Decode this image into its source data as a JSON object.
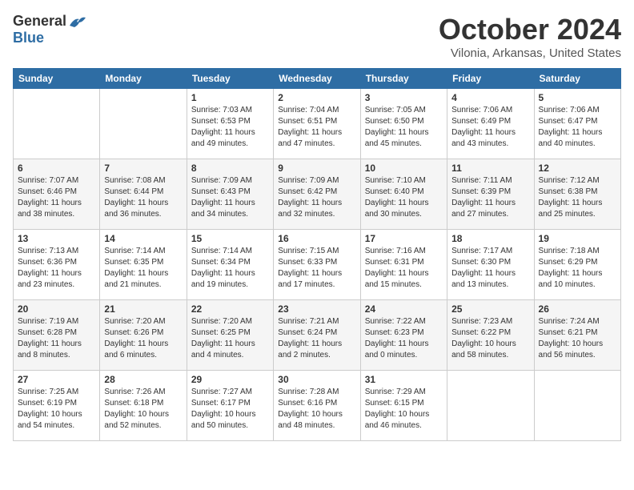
{
  "logo": {
    "general": "General",
    "blue": "Blue"
  },
  "title": "October 2024",
  "location": "Vilonia, Arkansas, United States",
  "headers": [
    "Sunday",
    "Monday",
    "Tuesday",
    "Wednesday",
    "Thursday",
    "Friday",
    "Saturday"
  ],
  "weeks": [
    {
      "shaded": false,
      "days": [
        {
          "num": "",
          "info": ""
        },
        {
          "num": "",
          "info": ""
        },
        {
          "num": "1",
          "info": "Sunrise: 7:03 AM\nSunset: 6:53 PM\nDaylight: 11 hours and 49 minutes."
        },
        {
          "num": "2",
          "info": "Sunrise: 7:04 AM\nSunset: 6:51 PM\nDaylight: 11 hours and 47 minutes."
        },
        {
          "num": "3",
          "info": "Sunrise: 7:05 AM\nSunset: 6:50 PM\nDaylight: 11 hours and 45 minutes."
        },
        {
          "num": "4",
          "info": "Sunrise: 7:06 AM\nSunset: 6:49 PM\nDaylight: 11 hours and 43 minutes."
        },
        {
          "num": "5",
          "info": "Sunrise: 7:06 AM\nSunset: 6:47 PM\nDaylight: 11 hours and 40 minutes."
        }
      ]
    },
    {
      "shaded": true,
      "days": [
        {
          "num": "6",
          "info": "Sunrise: 7:07 AM\nSunset: 6:46 PM\nDaylight: 11 hours and 38 minutes."
        },
        {
          "num": "7",
          "info": "Sunrise: 7:08 AM\nSunset: 6:44 PM\nDaylight: 11 hours and 36 minutes."
        },
        {
          "num": "8",
          "info": "Sunrise: 7:09 AM\nSunset: 6:43 PM\nDaylight: 11 hours and 34 minutes."
        },
        {
          "num": "9",
          "info": "Sunrise: 7:09 AM\nSunset: 6:42 PM\nDaylight: 11 hours and 32 minutes."
        },
        {
          "num": "10",
          "info": "Sunrise: 7:10 AM\nSunset: 6:40 PM\nDaylight: 11 hours and 30 minutes."
        },
        {
          "num": "11",
          "info": "Sunrise: 7:11 AM\nSunset: 6:39 PM\nDaylight: 11 hours and 27 minutes."
        },
        {
          "num": "12",
          "info": "Sunrise: 7:12 AM\nSunset: 6:38 PM\nDaylight: 11 hours and 25 minutes."
        }
      ]
    },
    {
      "shaded": false,
      "days": [
        {
          "num": "13",
          "info": "Sunrise: 7:13 AM\nSunset: 6:36 PM\nDaylight: 11 hours and 23 minutes."
        },
        {
          "num": "14",
          "info": "Sunrise: 7:14 AM\nSunset: 6:35 PM\nDaylight: 11 hours and 21 minutes."
        },
        {
          "num": "15",
          "info": "Sunrise: 7:14 AM\nSunset: 6:34 PM\nDaylight: 11 hours and 19 minutes."
        },
        {
          "num": "16",
          "info": "Sunrise: 7:15 AM\nSunset: 6:33 PM\nDaylight: 11 hours and 17 minutes."
        },
        {
          "num": "17",
          "info": "Sunrise: 7:16 AM\nSunset: 6:31 PM\nDaylight: 11 hours and 15 minutes."
        },
        {
          "num": "18",
          "info": "Sunrise: 7:17 AM\nSunset: 6:30 PM\nDaylight: 11 hours and 13 minutes."
        },
        {
          "num": "19",
          "info": "Sunrise: 7:18 AM\nSunset: 6:29 PM\nDaylight: 11 hours and 10 minutes."
        }
      ]
    },
    {
      "shaded": true,
      "days": [
        {
          "num": "20",
          "info": "Sunrise: 7:19 AM\nSunset: 6:28 PM\nDaylight: 11 hours and 8 minutes."
        },
        {
          "num": "21",
          "info": "Sunrise: 7:20 AM\nSunset: 6:26 PM\nDaylight: 11 hours and 6 minutes."
        },
        {
          "num": "22",
          "info": "Sunrise: 7:20 AM\nSunset: 6:25 PM\nDaylight: 11 hours and 4 minutes."
        },
        {
          "num": "23",
          "info": "Sunrise: 7:21 AM\nSunset: 6:24 PM\nDaylight: 11 hours and 2 minutes."
        },
        {
          "num": "24",
          "info": "Sunrise: 7:22 AM\nSunset: 6:23 PM\nDaylight: 11 hours and 0 minutes."
        },
        {
          "num": "25",
          "info": "Sunrise: 7:23 AM\nSunset: 6:22 PM\nDaylight: 10 hours and 58 minutes."
        },
        {
          "num": "26",
          "info": "Sunrise: 7:24 AM\nSunset: 6:21 PM\nDaylight: 10 hours and 56 minutes."
        }
      ]
    },
    {
      "shaded": false,
      "days": [
        {
          "num": "27",
          "info": "Sunrise: 7:25 AM\nSunset: 6:19 PM\nDaylight: 10 hours and 54 minutes."
        },
        {
          "num": "28",
          "info": "Sunrise: 7:26 AM\nSunset: 6:18 PM\nDaylight: 10 hours and 52 minutes."
        },
        {
          "num": "29",
          "info": "Sunrise: 7:27 AM\nSunset: 6:17 PM\nDaylight: 10 hours and 50 minutes."
        },
        {
          "num": "30",
          "info": "Sunrise: 7:28 AM\nSunset: 6:16 PM\nDaylight: 10 hours and 48 minutes."
        },
        {
          "num": "31",
          "info": "Sunrise: 7:29 AM\nSunset: 6:15 PM\nDaylight: 10 hours and 46 minutes."
        },
        {
          "num": "",
          "info": ""
        },
        {
          "num": "",
          "info": ""
        }
      ]
    }
  ]
}
